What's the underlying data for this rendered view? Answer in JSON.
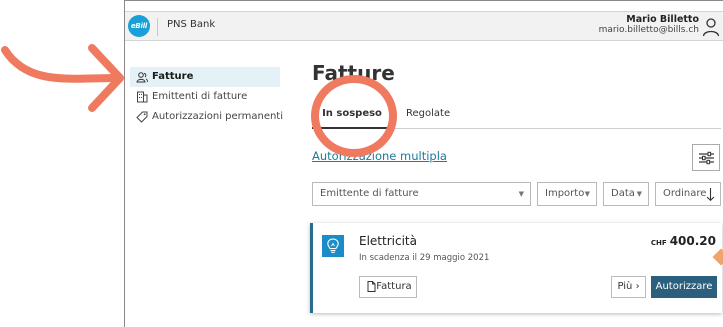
{
  "header": {
    "logo_text": "eBill",
    "bank_name": "PNS Bank",
    "user_name": "Mario Billetto",
    "user_email": "mario.billetto@bills.ch"
  },
  "sidebar": {
    "items": [
      {
        "label": "Fatture",
        "icon": "people-icon",
        "active": true
      },
      {
        "label": "Emittenti di fatture",
        "icon": "building-icon",
        "active": false
      },
      {
        "label": "Autorizzazioni permanenti",
        "icon": "tag-icon",
        "active": false
      }
    ]
  },
  "main": {
    "title": "Fatture",
    "tabs": [
      {
        "label": "In sospeso",
        "active": true
      },
      {
        "label": "Regolate",
        "active": false
      }
    ],
    "multi_link": "Autorizzazione multipla",
    "filters": {
      "issuer_placeholder": "Emittente di fatture",
      "amount": "Importo",
      "date": "Data",
      "sort": "Ordinare"
    },
    "bill": {
      "title": "Elettricità",
      "due": "In scadenza il 29 maggio 2021",
      "currency": "CHF",
      "amount": "400.20",
      "invoice_label": "Fattura",
      "more_label": "Più",
      "authorize_label": "Autorizzare",
      "icon": "lightbulb-icon"
    }
  },
  "colors": {
    "accent": "#2a5f7d",
    "link": "#1e7a9a",
    "logo": "#1aa0d8",
    "annotation": "#ef7a60",
    "active_bg": "#e4f1f6"
  }
}
